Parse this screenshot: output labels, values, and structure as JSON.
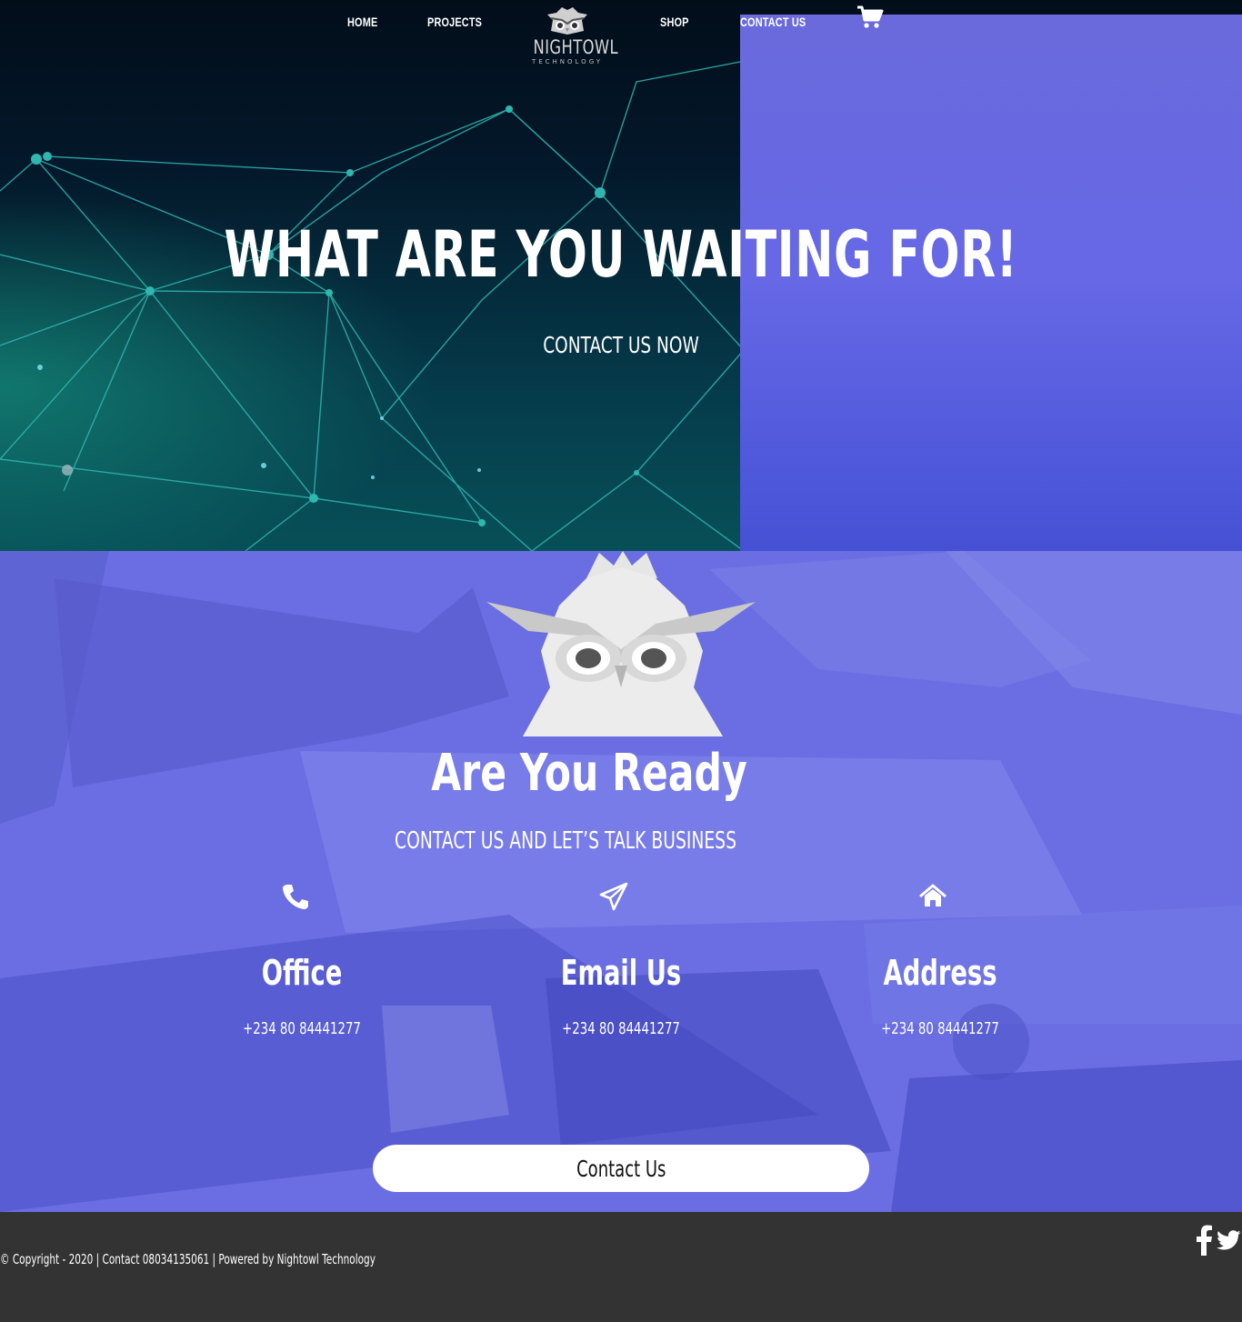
{
  "nav": {
    "home": "HOME",
    "projects": "PROJECTS",
    "shop": "SHOP",
    "contact": "CONTACT US",
    "cart_icon": "shopping-cart-icon"
  },
  "logo": {
    "name": "NIGHTOWL",
    "subtitle": "TECHNOLOGY"
  },
  "hero": {
    "title": "WHAT ARE YOU WAITING FOR!",
    "cta": "CONTACT US NOW"
  },
  "contact": {
    "title": "Are You Ready",
    "subtitle": "CONTACT US AND LET’S TALK BUSINESS",
    "columns": [
      {
        "icon": "phone-icon",
        "title": "Office",
        "value": "+234 80 84441277"
      },
      {
        "icon": "paper-plane-icon",
        "title": "Email Us",
        "value": "+234 80 84441277"
      },
      {
        "icon": "home-icon",
        "title": "Address",
        "value": "+234 80 84441277"
      }
    ],
    "button": "Contact Us"
  },
  "footer": {
    "text": "© Copyright - 2020 | Contact 08034135061 | Powered by Nightowl Technology",
    "social": [
      "facebook-icon",
      "twitter-icon"
    ]
  },
  "colors": {
    "hero_bg": "#03182a",
    "network_line": "#2fb6b0",
    "contact_bg": "#6668e6",
    "footer_bg": "#333333",
    "button_bg": "#ffffff"
  }
}
